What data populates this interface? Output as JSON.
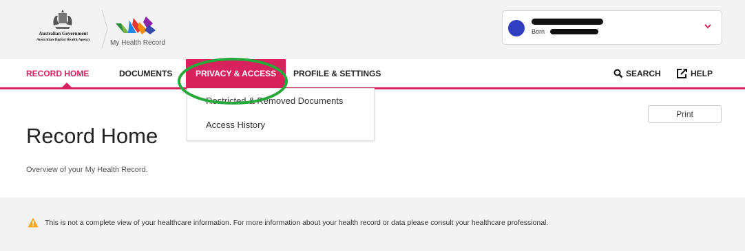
{
  "header": {
    "gov_line1": "Australian Government",
    "gov_line2": "Australian Digital Health Agency",
    "app_name": "My Health Record"
  },
  "profile": {
    "born_label": "Born",
    "chevron_icon": "chevron-down-icon",
    "accent": "#d8225d"
  },
  "nav": {
    "items": [
      {
        "label": "RECORD HOME"
      },
      {
        "label": "DOCUMENTS"
      },
      {
        "label": "PRIVACY & ACCESS"
      },
      {
        "label": "PROFILE & SETTINGS"
      }
    ],
    "search_label": "SEARCH",
    "help_label": "HELP"
  },
  "dropdown": {
    "items": [
      {
        "label": "Restricted & Removed Documents"
      },
      {
        "label": "Access History"
      }
    ]
  },
  "main": {
    "print_label": "Print",
    "title": "Record Home",
    "subtitle": "Overview of your My Health Record."
  },
  "notice": {
    "icon": "warning-icon",
    "text": "This is not a complete view of your healthcare information. For more information about your health record or data please consult your healthcare professional."
  }
}
